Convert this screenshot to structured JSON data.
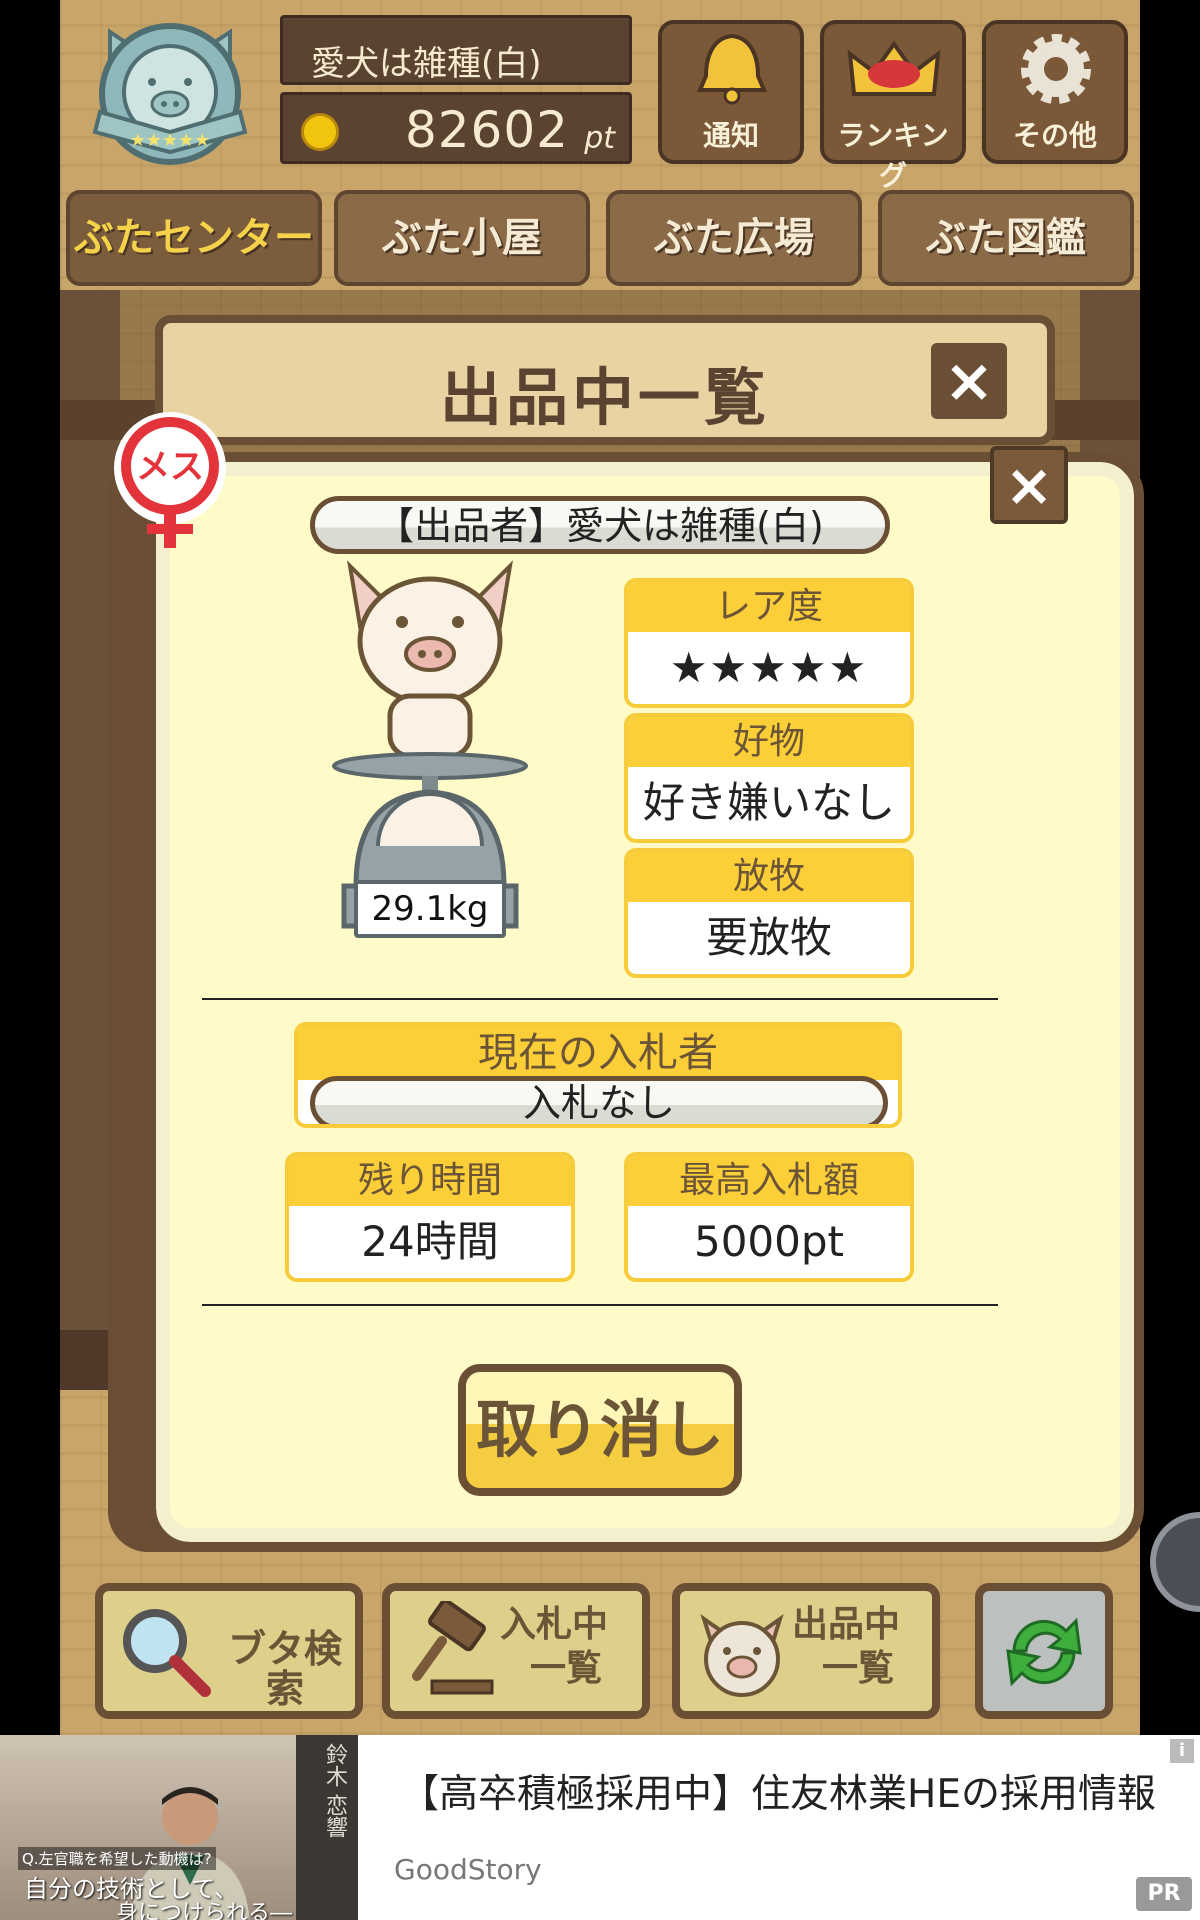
{
  "header": {
    "user_name": "愛犬は雑種(白)",
    "points_value": "82602",
    "points_unit": "pt",
    "buttons": [
      {
        "label": "通知",
        "icon": "bell-icon"
      },
      {
        "label": "ランキング",
        "icon": "crown-icon"
      },
      {
        "label": "その他",
        "icon": "gear-icon"
      }
    ]
  },
  "tabs": [
    {
      "label": "ぶたセンター",
      "active": true
    },
    {
      "label": "ぶた小屋",
      "active": false
    },
    {
      "label": "ぶた広場",
      "active": false
    },
    {
      "label": "ぶた図鑑",
      "active": false
    }
  ],
  "window": {
    "title": "出品中一覧",
    "close": "×"
  },
  "dialog": {
    "close": "×",
    "gender_badge": "メス",
    "seller_label": "【出品者】愛犬は雑種(白)",
    "weight": "29.1kg",
    "rarity": {
      "label": "レア度",
      "value": "★★★★★"
    },
    "favorite": {
      "label": "好物",
      "value": "好き嫌いなし"
    },
    "grazing": {
      "label": "放牧",
      "value": "要放牧"
    },
    "current_bidder": {
      "label": "現在の入札者",
      "value": "入札なし"
    },
    "time_left": {
      "label": "残り時間",
      "value": "24時間"
    },
    "max_bid": {
      "label": "最高入札額",
      "value": "5000pt"
    },
    "cancel_button": "取り消し"
  },
  "toolbar": [
    {
      "label": "ブタ検索",
      "icon": "magnifier-icon"
    },
    {
      "label_line1": "入札中",
      "label_line2": "一覧",
      "icon": "gavel-icon"
    },
    {
      "label_line1": "出品中",
      "label_line2": "一覧",
      "icon": "pig-face-icon"
    },
    {
      "icon": "refresh-icon"
    }
  ],
  "ad": {
    "title": "【高卒積極採用中】住友林業HEの採用情報",
    "source": "GoodStory",
    "pr_label": "PR",
    "info_label": "i",
    "image_question": "Q.左官職を希望した動機は?",
    "image_caption1": "自分の技術として、",
    "image_caption2": "身につけられる―",
    "book_text": "鈴木 恋響"
  },
  "colors": {
    "wood": "#c9a56a",
    "dark_brown": "#6b4f35",
    "card_header": "#fccf38",
    "panel_bg": "#fffbc9",
    "star": "#ef8a86",
    "active_tab_text": "#f5d24a"
  }
}
